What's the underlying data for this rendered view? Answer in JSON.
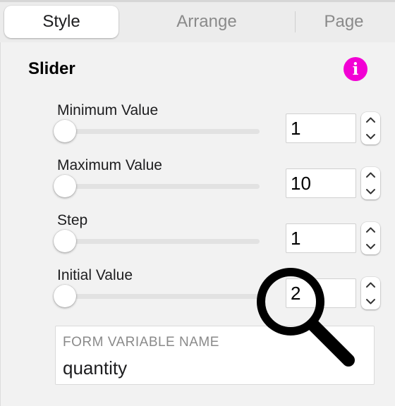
{
  "tabs": [
    {
      "label": "Style",
      "active": true
    },
    {
      "label": "Arrange",
      "active": false
    },
    {
      "label": "Page",
      "active": false
    }
  ],
  "section": {
    "title": "Slider",
    "info_icon": "info-icon",
    "info_color": "#f200d4"
  },
  "fields": [
    {
      "label": "Minimum Value",
      "value": "1"
    },
    {
      "label": "Maximum Value",
      "value": "10"
    },
    {
      "label": "Step",
      "value": "1"
    },
    {
      "label": "Initial Value",
      "value": "2"
    }
  ],
  "form_variable": {
    "label": "FORM VARIABLE NAME",
    "value": "quantity"
  },
  "overlay": {
    "icon": "magnifier-icon"
  }
}
